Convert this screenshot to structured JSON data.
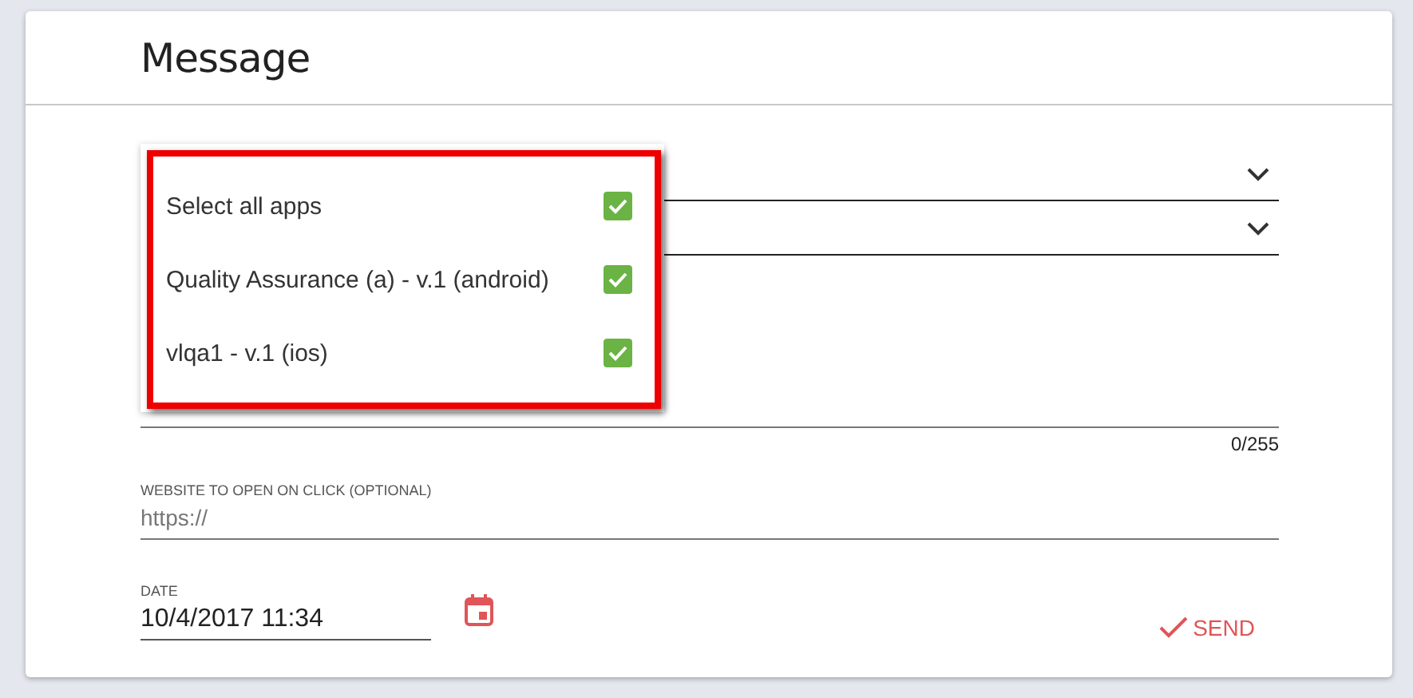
{
  "title": "Message",
  "selects": [
    {
      "expanded": true,
      "options": [
        {
          "label": "Select all apps",
          "checked": true
        },
        {
          "label": "Quality Assurance (a) - v.1 (android)",
          "checked": true
        },
        {
          "label": "vlqa1 - v.1 (ios)",
          "checked": true
        }
      ]
    },
    {
      "expanded": false
    }
  ],
  "message": {
    "counter": "0/255"
  },
  "website": {
    "label": "WEBSITE TO OPEN ON CLICK (OPTIONAL)",
    "placeholder": "https://"
  },
  "date": {
    "label": "DATE",
    "value": "10/4/2017 11:34"
  },
  "send_button": "SEND"
}
